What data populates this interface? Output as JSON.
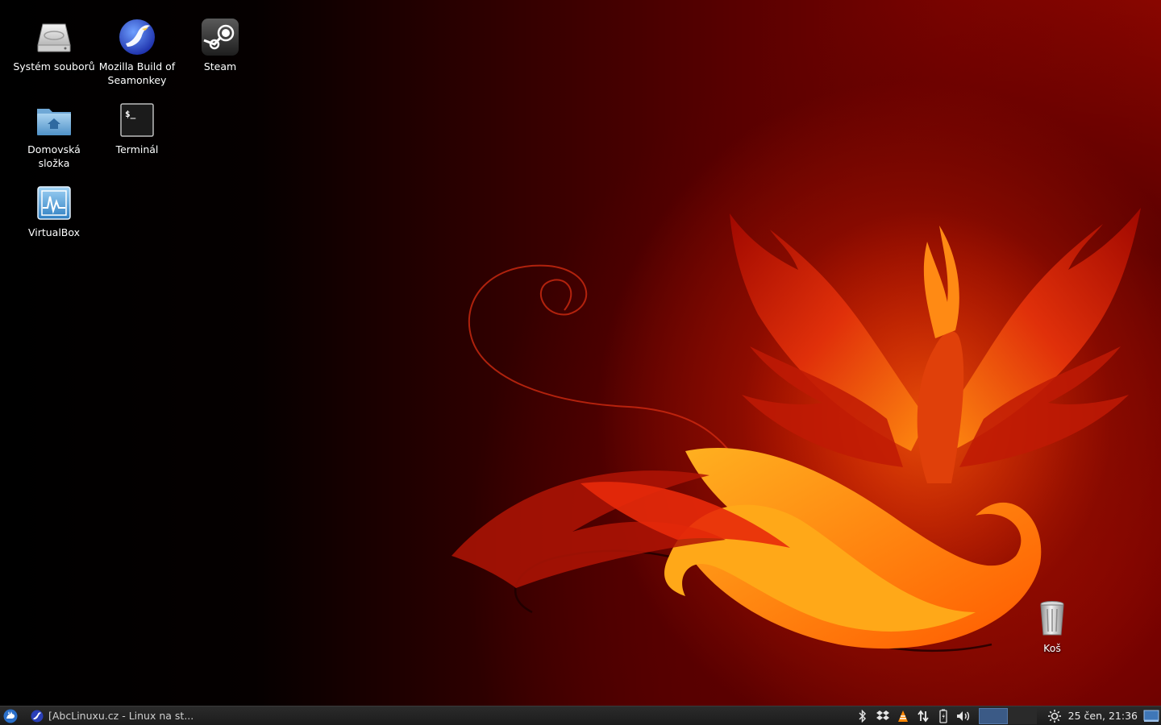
{
  "desktop": {
    "icons": [
      {
        "label": "Systém souborů",
        "icon": "drive-icon"
      },
      {
        "label": "Mozilla Build of Seamonkey",
        "icon": "seamonkey-icon"
      },
      {
        "label": "Steam",
        "icon": "steam-icon"
      },
      {
        "label": "Domovská složka",
        "icon": "home-folder-icon"
      },
      {
        "label": "Terminál",
        "icon": "terminal-icon"
      },
      {
        "label": "VirtualBox",
        "icon": "virtualbox-icon"
      },
      {
        "label": "Koš",
        "icon": "trash-icon"
      }
    ],
    "terminal_prompt": "$_",
    "wallpaper_colors": {
      "dark": "#000000",
      "red": "#8a0600",
      "flame": "#ff9a1a"
    }
  },
  "taskbar": {
    "start_icon": "xfce-mouse-icon",
    "task_label": "[AbcLinuxu.cz - Linux na st...",
    "task_icon": "seamonkey-icon",
    "tray_icons": [
      "bluetooth-icon",
      "dropbox-icon",
      "vlc-icon",
      "network-icon",
      "battery-icon",
      "volume-icon"
    ],
    "workspaces": {
      "active": 1,
      "count": 2
    },
    "weather_icon": "sun-icon",
    "clock": "25 čen, 21:36",
    "show_desktop_icon": "show-desktop-icon"
  }
}
